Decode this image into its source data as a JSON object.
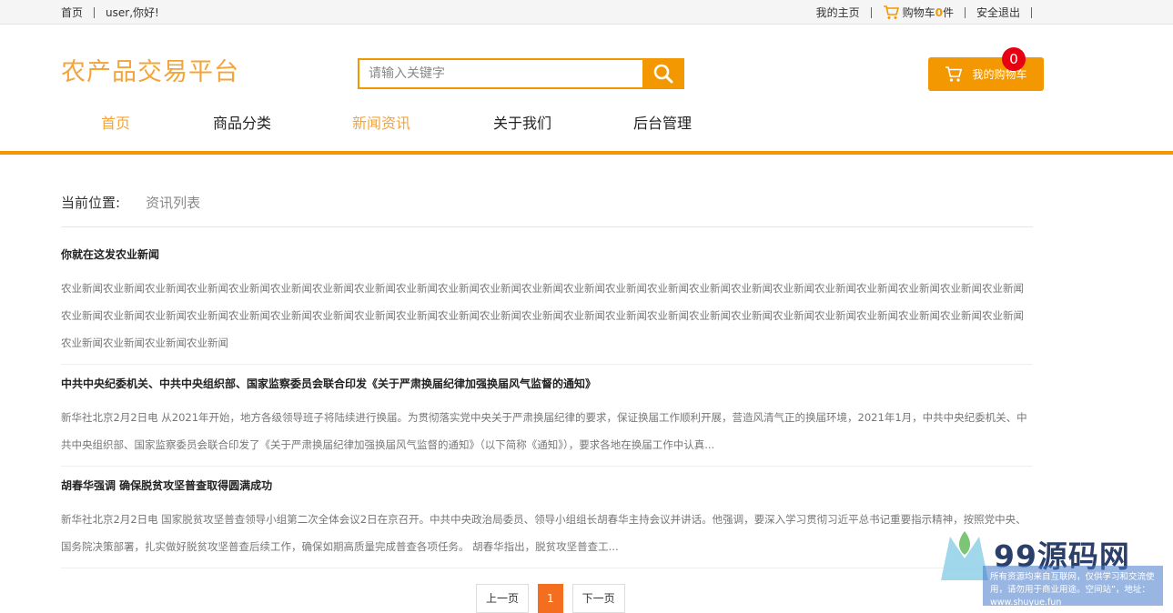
{
  "topbar": {
    "home": "首页",
    "greeting": "user,你好!",
    "my_home": "我的主页",
    "cart_prefix": "购物车",
    "cart_count": "0",
    "cart_suffix": "件",
    "logout": "安全退出"
  },
  "header": {
    "logo": "农产品交易平台",
    "search_placeholder": "请输入关键字",
    "cart_button": "我的购物车",
    "cart_badge": "0"
  },
  "nav": {
    "items": [
      "首页",
      "商品分类",
      "新闻资讯",
      "关于我们",
      "后台管理"
    ]
  },
  "breadcrumb": {
    "label": "当前位置:",
    "current": "资讯列表"
  },
  "news": [
    {
      "title": "你就在这发农业新闻",
      "summary": "农业新闻农业新闻农业新闻农业新闻农业新闻农业新闻农业新闻农业新闻农业新闻农业新闻农业新闻农业新闻农业新闻农业新闻农业新闻农业新闻农业新闻农业新闻农业新闻农业新闻农业新闻农业新闻农业新闻农业新闻农业新闻农业新闻农业新闻农业新闻农业新闻农业新闻农业新闻农业新闻农业新闻农业新闻农业新闻农业新闻农业新闻农业新闻农业新闻农业新闻农业新闻农业新闻农业新闻农业新闻农业新闻农业新闻农业新闻农业新闻农业新闻农业新闻"
    },
    {
      "title": "中共中央纪委机关、中共中央组织部、国家监察委员会联合印发《关于严肃换届纪律加强换届风气监督的通知》",
      "summary": "新华社北京2月2日电 从2021年开始，地方各级领导班子将陆续进行换届。为贯彻落实党中央关于严肃换届纪律的要求，保证换届工作顺利开展，营造风清气正的换届环境，2021年1月，中共中央纪委机关、中共中央组织部、国家监察委员会联合印发了《关于严肃换届纪律加强换届风气监督的通知》（以下简称《通知》），要求各地在换届工作中认真..."
    },
    {
      "title": "胡春华强调 确保脱贫攻坚普查取得圆满成功",
      "summary": "新华社北京2月2日电 国家脱贫攻坚普查领导小组第二次全体会议2日在京召开。中共中央政治局委员、领导小组组长胡春华主持会议并讲话。他强调，要深入学习贯彻习近平总书记重要指示精神，按照党中央、国务院决策部署，扎实做好脱贫攻坚普查后续工作，确保如期高质量完成普查各项任务。      胡春华指出，脱贫攻坚普查工..."
    }
  ],
  "pagination": {
    "prev": "上一页",
    "current": "1",
    "next": "下一页"
  },
  "watermark": {
    "site": "99源码网",
    "notice": "所有资源均来自互联网，仅供学习和交流使用，请勿用于商业用途。空间站”，地址：www.shuyue.fun"
  },
  "colors": {
    "accent": "#f39800",
    "logo": "#f3a43a",
    "badge": "#e60012",
    "page_active": "#f36e1e"
  }
}
